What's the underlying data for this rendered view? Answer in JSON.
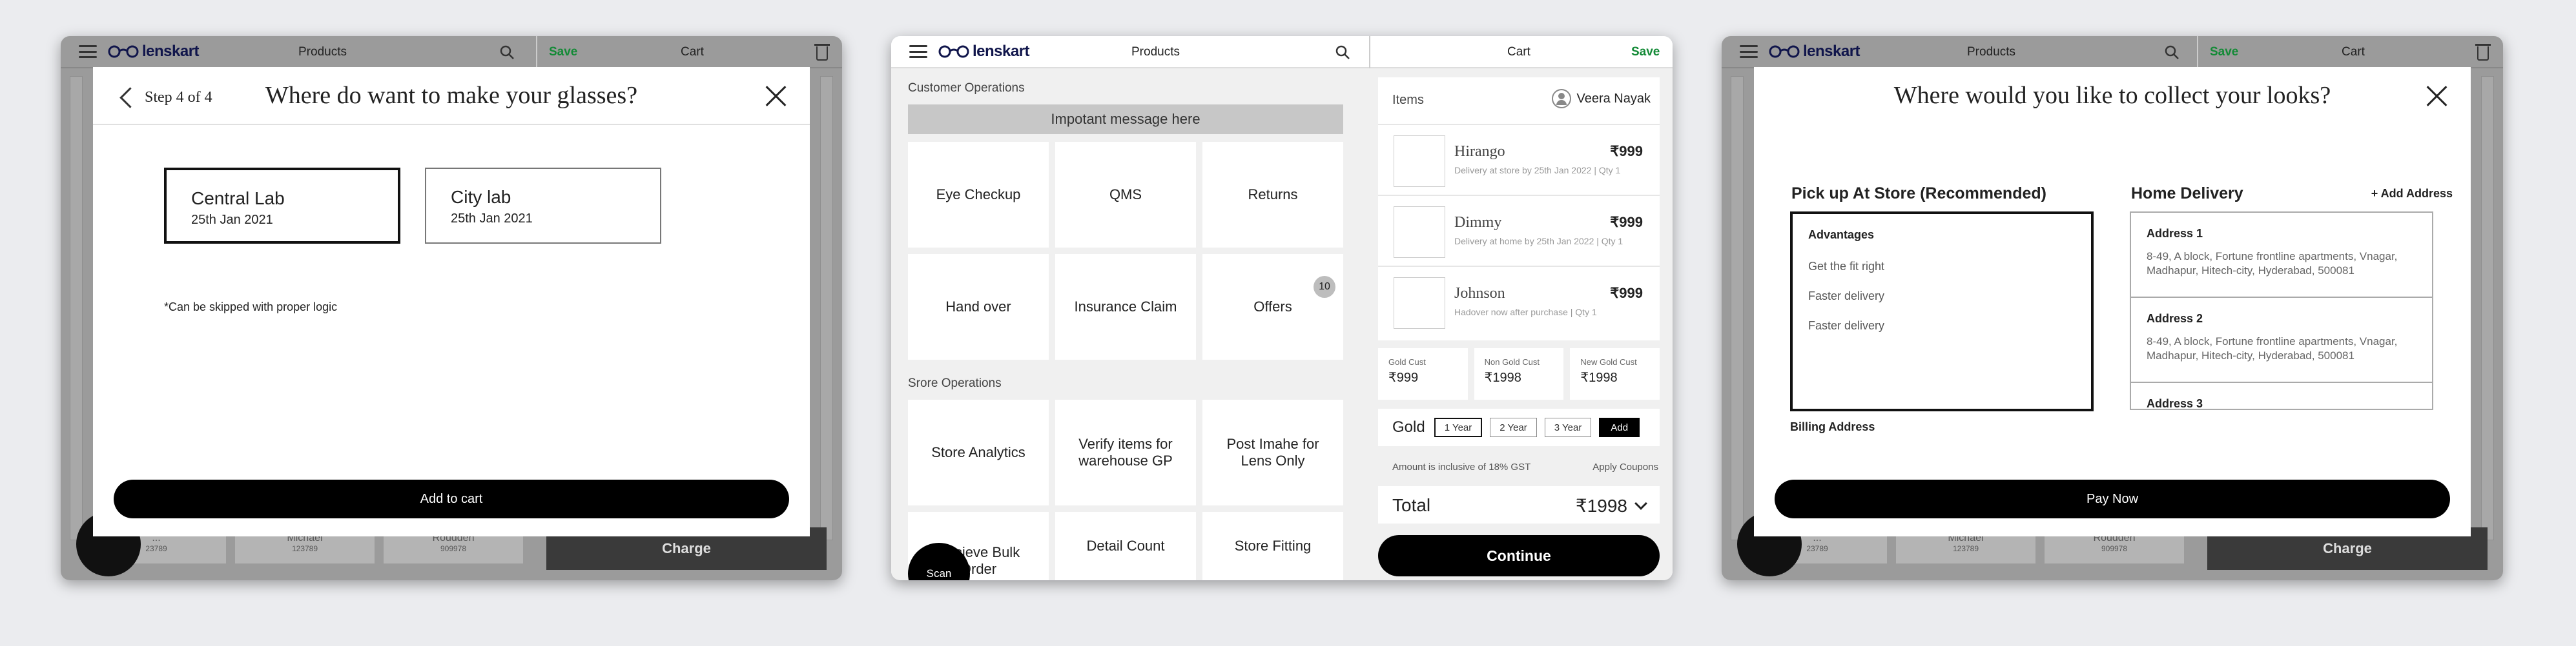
{
  "appbar": {
    "brand": "lenskart",
    "products": "Products",
    "save": "Save",
    "cart": "Cart"
  },
  "screen1": {
    "step": "Step 4 of 4",
    "title": "Where do want to make your glasses?",
    "labs": [
      {
        "name": "Central Lab",
        "date": "25th Jan 2021"
      },
      {
        "name": "City lab",
        "date": "25th Jan 2021"
      }
    ],
    "note": "*Can be skipped with proper logic",
    "cta": "Add to cart",
    "bg_tiles": [
      {
        "name": "...",
        "code": "23789"
      },
      {
        "name": "Michael",
        "code": "123789"
      },
      {
        "name": "Roudden",
        "code": "909978"
      }
    ],
    "bg_charge": "Charge"
  },
  "screen2": {
    "customer_ops_title": "Customer Operations",
    "message": "Impotant message here",
    "customer_ops": [
      "Eye Checkup",
      "QMS",
      "Returns",
      "Hand over",
      "Insurance Claim",
      "Offers"
    ],
    "offers_badge": "10",
    "store_ops_title": "Srore Operations",
    "store_ops": [
      "Store Analytics",
      "Verify items for warehouse GP",
      "Post Imahe for Lens Only",
      "Recieve Bulk Order",
      "Detail Count",
      "Store Fitting"
    ],
    "scan": "Scan",
    "cart": {
      "items_label": "Items",
      "user": "Veera Nayak",
      "items": [
        {
          "name": "Hirango",
          "price": "₹999",
          "desc": "Delivery at store by 25th Jan 2022  | Qty 1"
        },
        {
          "name": "Dimmy",
          "price": "₹999",
          "desc": "Delivery at home by 25th Jan 2022  | Qty 1"
        },
        {
          "name": "Johnson",
          "price": "₹999",
          "desc": "Hadover now after purchase  | Qty 1"
        }
      ],
      "tiers": [
        {
          "label": "Gold Cust",
          "value": "₹999"
        },
        {
          "label": "Non Gold Cust",
          "value": "₹1998"
        },
        {
          "label": "New Gold Cust",
          "value": "₹1998"
        }
      ],
      "gold_label": "Gold",
      "years": [
        "1 Year",
        "2 Year",
        "3 Year"
      ],
      "add": "Add",
      "gst_note": "Amount is inclusive of 18% GST",
      "coupons": "Apply Coupons",
      "total_label": "Total",
      "total_value": "₹1998",
      "continue": "Continue"
    }
  },
  "screen3": {
    "title": "Where would you like to collect your looks?",
    "pickup_title": "Pick up At Store (Recommended)",
    "advantages_title": "Advantages",
    "advantages": [
      "Get the fit right",
      "Faster delivery",
      "Faster delivery"
    ],
    "billing": "Billing Address",
    "home_title": "Home Delivery",
    "add_address": "+  Add Address",
    "addresses": [
      {
        "title": "Address 1",
        "text": "8-49, A block, Fortune frontline apartments, Vnagar, Madhapur, Hitech-city, Hyderabad, 500081"
      },
      {
        "title": "Address 2",
        "text": "8-49, A block, Fortune frontline apartments, Vnagar, Madhapur, Hitech-city, Hyderabad, 500081"
      },
      {
        "title": "Address 3",
        "text": ""
      }
    ],
    "cta": "Pay Now",
    "bg_charge": "Charge"
  },
  "colors": {
    "brand": "#10154b",
    "save": "#138a36",
    "primary": "#000000"
  }
}
